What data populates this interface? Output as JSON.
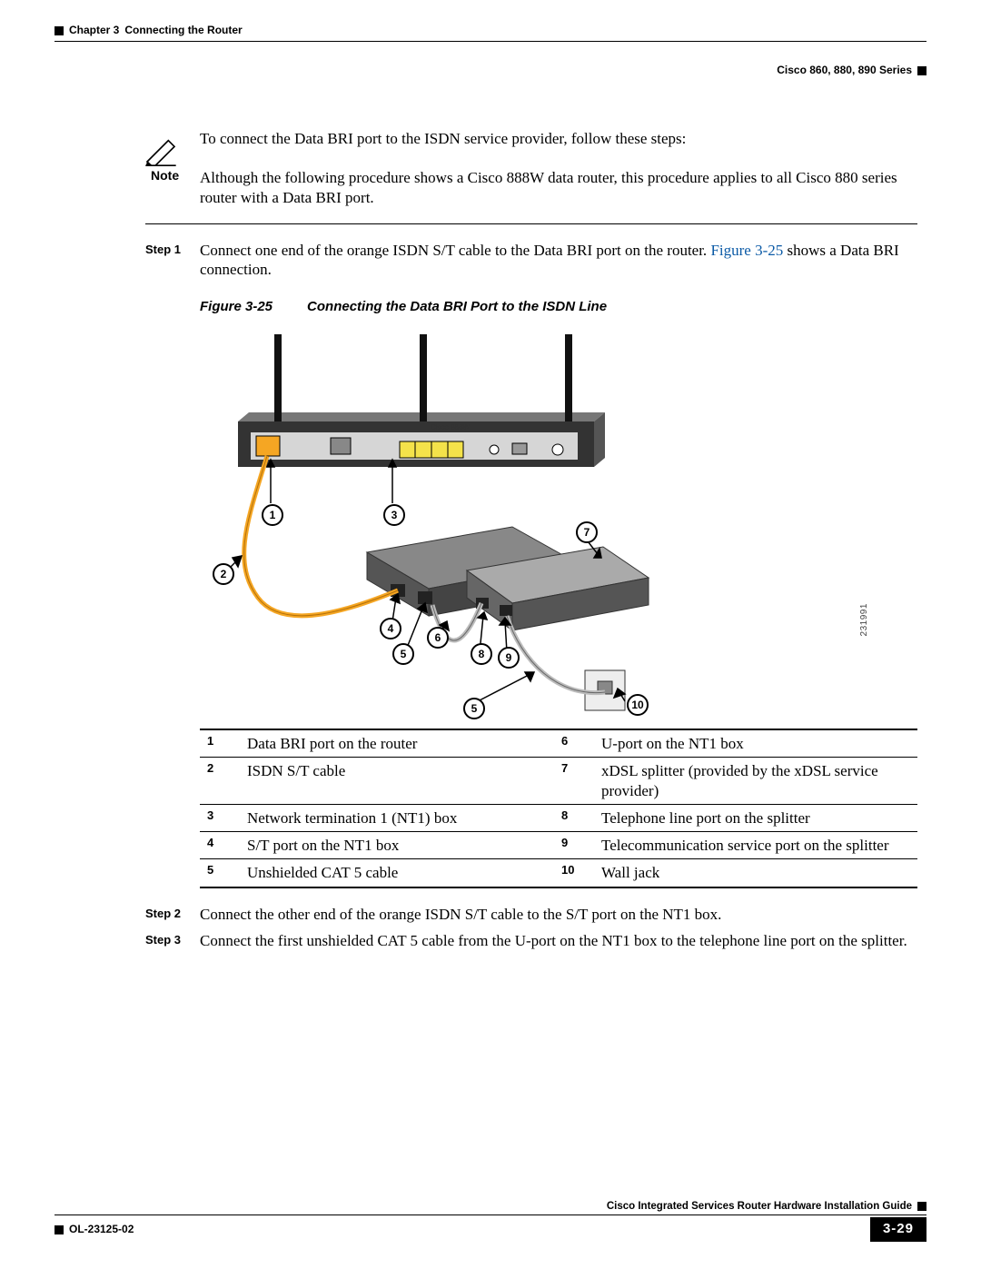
{
  "header": {
    "chapter": "Chapter 3",
    "chapter_title": "Connecting the Router",
    "series": "Cisco 860, 880, 890 Series"
  },
  "intro": "To connect the Data BRI port to the ISDN service provider, follow these steps:",
  "note": {
    "label": "Note",
    "text": "Although the following procedure shows a Cisco 888W data router, this procedure applies to all Cisco 880 series router with a Data BRI port."
  },
  "steps": {
    "s1": {
      "label": "Step 1",
      "text_a": "Connect one end of the orange ISDN S/T cable to the Data BRI port on the router. ",
      "figref": "Figure 3-25",
      "text_b": " shows a Data BRI connection."
    },
    "s2": {
      "label": "Step 2",
      "text": "Connect the other end of the orange ISDN S/T cable to the S/T port on the NT1 box."
    },
    "s3": {
      "label": "Step 3",
      "text": "Connect the first unshielded CAT 5 cable from the U-port on the NT1 box to the telephone line port on the splitter."
    }
  },
  "figure": {
    "label": "Figure 3-25",
    "caption": "Connecting the Data BRI Port to the ISDN Line",
    "idnum": "231991",
    "device_label": "Cisco 888W",
    "callouts": {
      "c1": "1",
      "c2": "2",
      "c3": "3",
      "c4": "4",
      "c5a": "5",
      "c5b": "5",
      "c6": "6",
      "c7": "7",
      "c8": "8",
      "c9": "9",
      "c10": "10"
    }
  },
  "legend": {
    "r1": {
      "n1": "1",
      "d1": "Data BRI port on the router",
      "n2": "6",
      "d2": "U-port on the NT1 box"
    },
    "r2": {
      "n1": "2",
      "d1": "ISDN S/T cable",
      "n2": "7",
      "d2": "xDSL splitter (provided by the xDSL service provider)"
    },
    "r3": {
      "n1": "3",
      "d1": "Network termination 1 (NT1) box",
      "n2": "8",
      "d2": "Telephone line port on the splitter"
    },
    "r4": {
      "n1": "4",
      "d1": "S/T port on the NT1 box",
      "n2": "9",
      "d2": "Telecommunication service port on the splitter"
    },
    "r5": {
      "n1": "5",
      "d1": "Unshielded CAT 5 cable",
      "n2": "10",
      "d2": "Wall jack"
    }
  },
  "footer": {
    "guide": "Cisco Integrated Services Router Hardware Installation Guide",
    "docnum": "OL-23125-02",
    "pagenum": "3-29"
  }
}
